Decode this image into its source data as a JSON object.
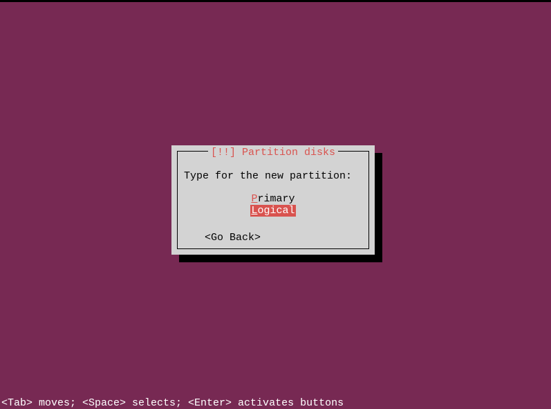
{
  "dialog": {
    "title_prefix": "[!!] ",
    "title": "Partition disks",
    "prompt": "Type for the new partition:",
    "options": [
      {
        "label": "Primary",
        "selected": false
      },
      {
        "label": "Logical",
        "selected": true
      }
    ],
    "go_back": "<Go Back>"
  },
  "footer": {
    "help": "<Tab> moves; <Space> selects; <Enter> activates buttons"
  }
}
